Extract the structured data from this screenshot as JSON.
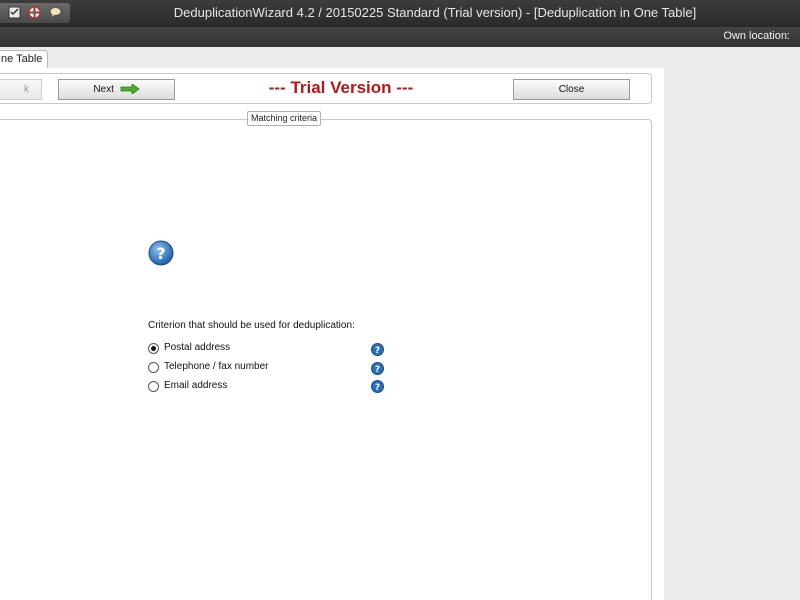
{
  "window": {
    "title": "DeduplicationWizard 4.2 / 20150225 Standard  (Trial version) - [Deduplication in One Table]",
    "own_location_label": "Own location:"
  },
  "tabs": {
    "active_label": "ne Table"
  },
  "toolbar": {
    "back_label": "k",
    "next_label": "Next",
    "close_label": "Close",
    "trial_text": "--- Trial Version ---"
  },
  "section": {
    "legend": "Matching criteria",
    "criterion_label": "Criterion that should be used for deduplication:",
    "options": [
      {
        "label": "Postal address",
        "selected": true
      },
      {
        "label": "Telephone / fax number",
        "selected": false
      },
      {
        "label": "Email address",
        "selected": false
      }
    ]
  },
  "colors": {
    "trial_red": "#b01a1a",
    "help_blue": "#2a6fb5",
    "next_arrow_green": "#4caf2a"
  },
  "icons": {
    "help": "help-icon",
    "next_arrow": "arrow-right-icon"
  }
}
